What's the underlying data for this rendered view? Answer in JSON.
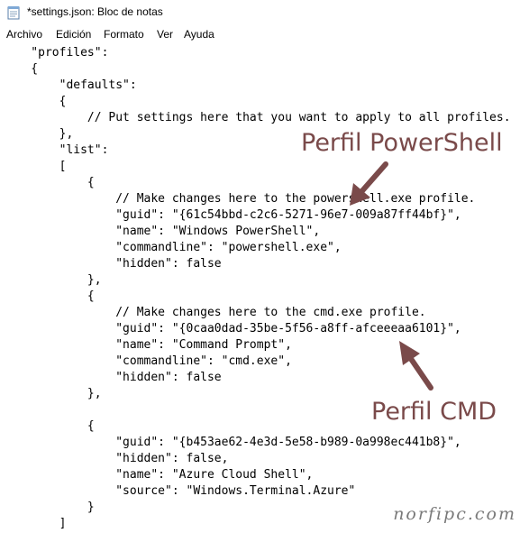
{
  "window": {
    "title": "*settings.json: Bloc de notas",
    "icon": "notepad-icon"
  },
  "menu": [
    "Archivo",
    "Edición",
    "Formato",
    "Ver",
    "Ayuda"
  ],
  "editor": {
    "lines": [
      "    \"profiles\":",
      "    {",
      "        \"defaults\":",
      "        {",
      "            // Put settings here that you want to apply to all profiles.",
      "        },",
      "        \"list\":",
      "        [",
      "            {",
      "                // Make changes here to the powershell.exe profile.",
      "                \"guid\": \"{61c54bbd-c2c6-5271-96e7-009a87ff44bf}\",",
      "                \"name\": \"Windows PowerShell\",",
      "                \"commandline\": \"powershell.exe\",",
      "                \"hidden\": false",
      "            },",
      "            {",
      "                // Make changes here to the cmd.exe profile.",
      "                \"guid\": \"{0caa0dad-35be-5f56-a8ff-afceeeaa6101}\",",
      "                \"name\": \"Command Prompt\",",
      "                \"commandline\": \"cmd.exe\",",
      "                \"hidden\": false",
      "            },",
      "",
      "            {",
      "                \"guid\": \"{b453ae62-4e3d-5e58-b989-0a998ec441b8}\",",
      "                \"hidden\": false,",
      "                \"name\": \"Azure Cloud Shell\",",
      "                \"source\": \"Windows.Terminal.Azure\"",
      "            }",
      "        ]"
    ]
  },
  "annotations": {
    "powershell": "Perfil PowerShell",
    "cmd": "Perfil CMD",
    "color": "#7a4a4a"
  },
  "watermark": "norfipc.com"
}
